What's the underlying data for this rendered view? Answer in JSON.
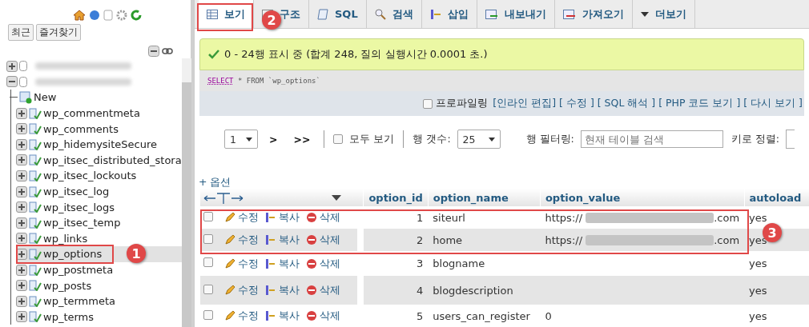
{
  "sidebar": {
    "recent_buttons": [
      "최근",
      "즐겨찾기"
    ],
    "tree": [
      {
        "kind": "database",
        "expanded": false
      },
      {
        "kind": "database",
        "expanded": true,
        "children": [
          {
            "kind": "new",
            "label": "New"
          },
          {
            "kind": "table",
            "label": "wp_commentmeta",
            "expanded": false,
            "selected": false
          },
          {
            "kind": "table",
            "label": "wp_comments",
            "expanded": false,
            "selected": false
          },
          {
            "kind": "table",
            "label": "wp_hidemysiteSecure",
            "expanded": false,
            "selected": false
          },
          {
            "kind": "table",
            "label": "wp_itsec_distributed_stora",
            "expanded": false,
            "selected": false
          },
          {
            "kind": "table",
            "label": "wp_itsec_lockouts",
            "expanded": false,
            "selected": false
          },
          {
            "kind": "table",
            "label": "wp_itsec_log",
            "expanded": false,
            "selected": false
          },
          {
            "kind": "table",
            "label": "wp_itsec_logs",
            "expanded": false,
            "selected": false
          },
          {
            "kind": "table",
            "label": "wp_itsec_temp",
            "expanded": false,
            "selected": false
          },
          {
            "kind": "table",
            "label": "wp_links",
            "expanded": false,
            "selected": false
          },
          {
            "kind": "table",
            "label": "wp_options",
            "expanded": false,
            "selected": true
          },
          {
            "kind": "table",
            "label": "wp_postmeta",
            "expanded": false,
            "selected": false
          },
          {
            "kind": "table",
            "label": "wp_posts",
            "expanded": false,
            "selected": false
          },
          {
            "kind": "table",
            "label": "wp_termmeta",
            "expanded": false,
            "selected": false
          },
          {
            "kind": "table",
            "label": "wp_terms",
            "expanded": false,
            "selected": false
          }
        ]
      }
    ]
  },
  "tabs": [
    {
      "label": "보기",
      "selected": true
    },
    {
      "label": "구조",
      "selected": false
    },
    {
      "label": "SQL",
      "selected": false
    },
    {
      "label": "검색",
      "selected": false
    },
    {
      "label": "삽입",
      "selected": false
    },
    {
      "label": "내보내기",
      "selected": false
    },
    {
      "label": "가져오기",
      "selected": false
    },
    {
      "label": "더보기",
      "selected": false
    }
  ],
  "message": "0 - 24행 표시 중 (합계 248, 질의 실행시간 0.0001 초.)",
  "sql": {
    "keyword": "SELECT",
    "rest": "* FROM `wp_options`"
  },
  "profiling": {
    "checked": false,
    "label": "프로파일링",
    "links": [
      "[인라인 편집]",
      "[ 수정 ]",
      "[ SQL 해석 ]",
      "[ PHP 코드 보기 ]",
      "[ 다시 보기 ]"
    ]
  },
  "nav": {
    "page": "1",
    "next": ">",
    "last": ">>",
    "show_all": {
      "label": "모두 보기",
      "checked": false
    },
    "rows_label": "행 갯수:",
    "rows": "25",
    "filter_label": "행 필터링:",
    "filter_placeholder": "현재 테이블 검색",
    "sort_label": "키로 정렬:"
  },
  "options_link": "+ 옵션",
  "columns": [
    "option_id",
    "option_name",
    "option_value",
    "autoload"
  ],
  "rows": [
    {
      "checked": false,
      "actions": [
        "수정",
        "복사",
        "삭제"
      ],
      "option_id": "1",
      "option_name": "siteurl",
      "value_start": "https://",
      "value_end": ".com",
      "autoload": "yes"
    },
    {
      "checked": false,
      "actions": [
        "수정",
        "복사",
        "삭제"
      ],
      "option_id": "2",
      "option_name": "home",
      "value_start": "https://",
      "value_end": ".com",
      "autoload": "yes"
    },
    {
      "checked": false,
      "actions": [
        "수정",
        "복사",
        "삭제"
      ],
      "option_id": "3",
      "option_name": "blogname",
      "autoload": "yes"
    },
    {
      "checked": false,
      "actions": [
        "수정",
        "복사",
        "삭제"
      ],
      "option_id": "4",
      "option_name": "blogdescription",
      "autoload": "yes"
    },
    {
      "checked": false,
      "actions": [
        "수정",
        "복사",
        "삭제"
      ],
      "option_id": "5",
      "option_name": "users_can_register",
      "value_start": "0",
      "autoload": "yes"
    }
  ],
  "annotations": [
    {
      "label": "1"
    },
    {
      "label": "2"
    },
    {
      "label": "3"
    }
  ]
}
